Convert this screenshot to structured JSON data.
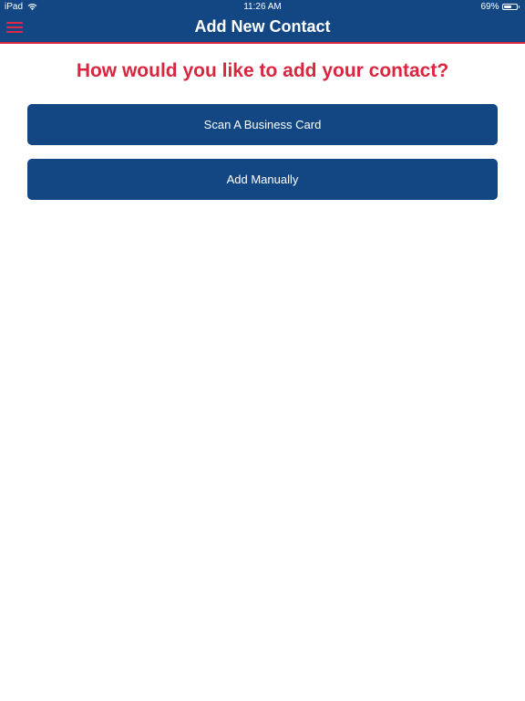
{
  "status_bar": {
    "device": "iPad",
    "time": "11:26 AM",
    "battery_text": "69%",
    "battery_level": 0.69
  },
  "nav": {
    "title": "Add New Contact",
    "menu_icon": "hamburger-menu-icon"
  },
  "prompt": "How would you like to add your contact?",
  "buttons": {
    "scan_label": "Scan A Business Card",
    "manual_label": "Add Manually"
  },
  "colors": {
    "primary": "#134784",
    "accent": "#d9263f",
    "background": "#ffffff"
  }
}
